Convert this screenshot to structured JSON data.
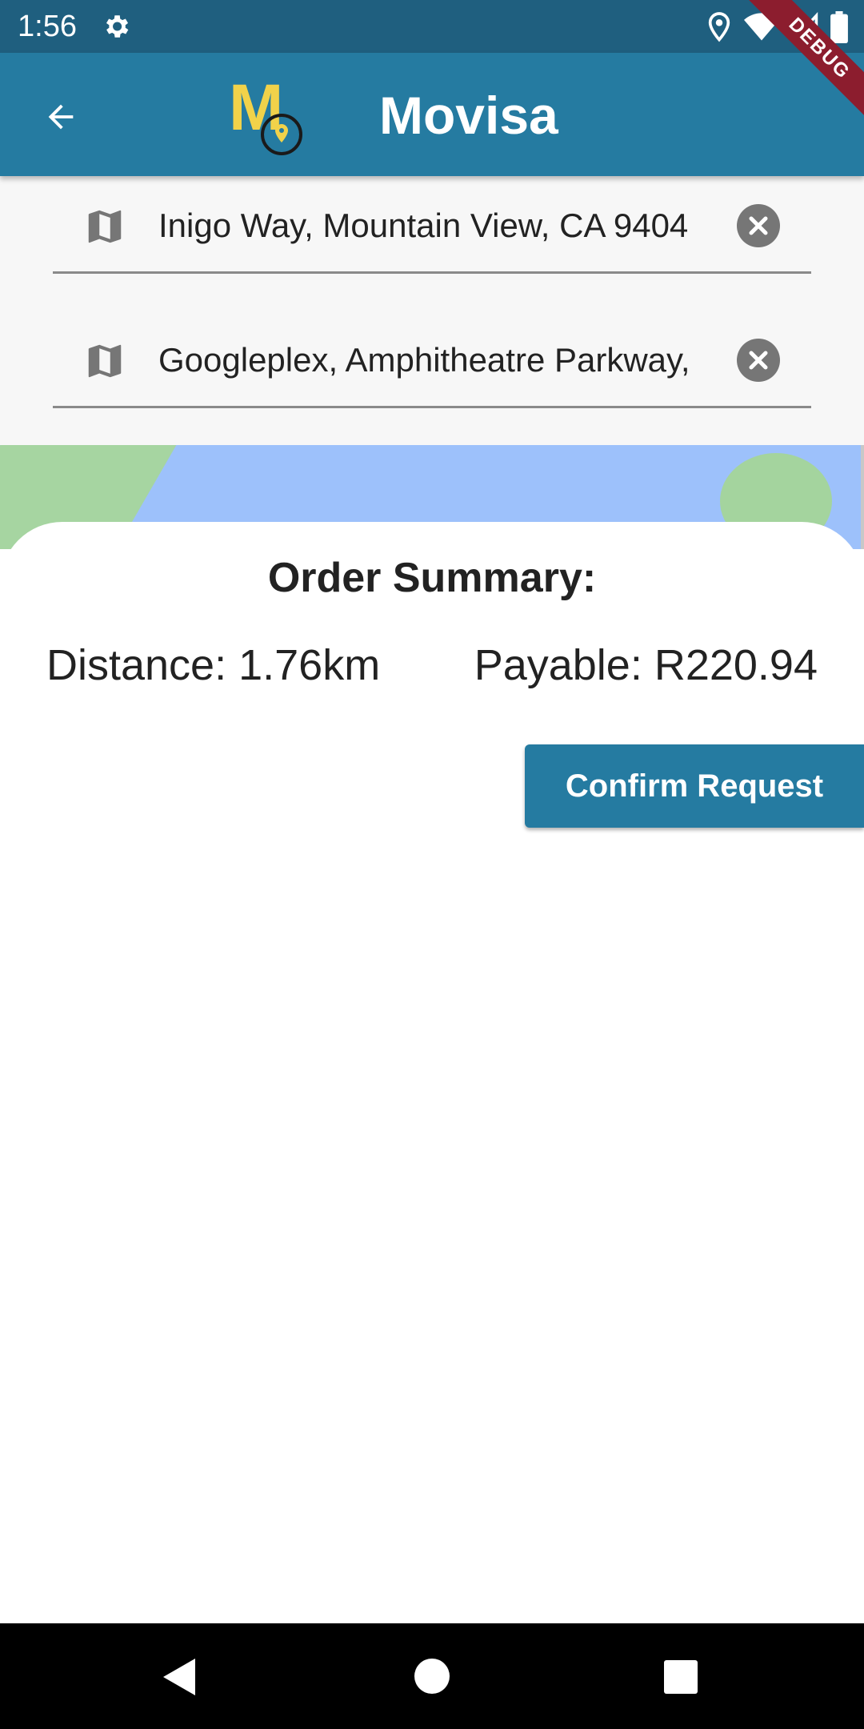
{
  "status_bar": {
    "time": "1:56",
    "icons": [
      "gear-icon",
      "location-icon",
      "wifi-icon",
      "signal-icon",
      "battery-icon"
    ]
  },
  "debug_banner": {
    "label": "DEBUG"
  },
  "app_bar": {
    "logo_letter": "M",
    "title": "Movisa",
    "back_icon": "arrow-left-icon"
  },
  "route": {
    "origin": "Inigo Way, Mountain View, CA 9404",
    "destination": "Googleplex, Amphitheatre Parkway,"
  },
  "order_summary": {
    "title": "Order Summary:",
    "distance": "Distance: 1.76km",
    "payable": "Payable: R220.94",
    "confirm_label": "Confirm Request"
  },
  "colors": {
    "primary": "#257ba1",
    "status_bar": "#1f5f7f",
    "logo_yellow": "#f1d24a",
    "debug_red": "#8c1d2e"
  }
}
